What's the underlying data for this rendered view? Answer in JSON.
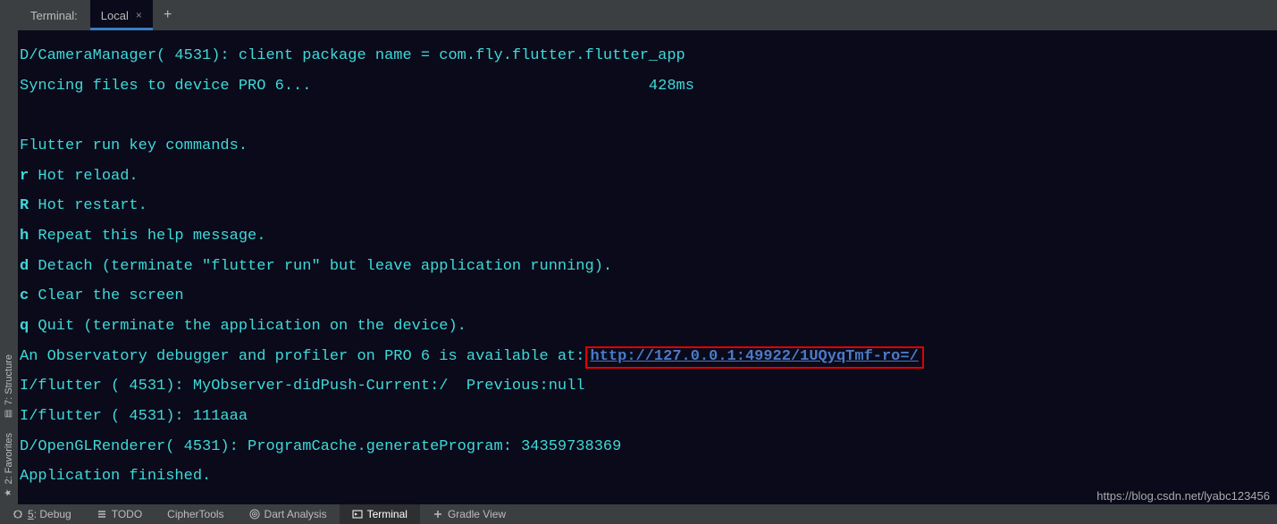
{
  "tabBar": {
    "label": "Terminal:",
    "activeTab": "Local",
    "addIcon": "+"
  },
  "sidebar": {
    "items": [
      {
        "label": "7: Structure",
        "icon": "▤"
      },
      {
        "label": "2: Favorites",
        "icon": "★"
      }
    ]
  },
  "terminal": {
    "lines": [
      {
        "type": "plain",
        "text": "D/CameraManager( 4531): client package name = com.fly.flutter.flutter_app"
      },
      {
        "type": "sync",
        "left": "Syncing files to device PRO 6...",
        "right": "428ms"
      },
      {
        "type": "blank",
        "text": ""
      },
      {
        "type": "plain",
        "text": "Flutter run key commands."
      },
      {
        "type": "cmd",
        "key": "r",
        "desc": " Hot reload."
      },
      {
        "type": "cmd",
        "key": "R",
        "desc": " Hot restart."
      },
      {
        "type": "cmd",
        "key": "h",
        "desc": " Repeat this help message."
      },
      {
        "type": "cmd",
        "key": "d",
        "desc": " Detach (terminate \"flutter run\" but leave application running)."
      },
      {
        "type": "cmd",
        "key": "c",
        "desc": " Clear the screen"
      },
      {
        "type": "cmd",
        "key": "q",
        "desc": " Quit (terminate the application on the device)."
      },
      {
        "type": "obs",
        "prefix": "An Observatory debugger and profiler on PRO 6 is available at:",
        "url": "http://127.0.0.1:49922/1UQyqTmf-ro=/"
      },
      {
        "type": "plain",
        "text": "I/flutter ( 4531): MyObserver-didPush-Current:/  Previous:null"
      },
      {
        "type": "plain",
        "text": "I/flutter ( 4531): 111aaa"
      },
      {
        "type": "plain",
        "text": "D/OpenGLRenderer( 4531): ProgramCache.generateProgram: 34359738369"
      },
      {
        "type": "plain",
        "text": "Application finished."
      }
    ]
  },
  "bottomBar": {
    "items": [
      {
        "label": "5: Debug",
        "icon": "bug",
        "hotkey": "5",
        "active": false
      },
      {
        "label": "TODO",
        "icon": "list",
        "active": false
      },
      {
        "label": "CipherTools",
        "icon": "",
        "active": false
      },
      {
        "label": "Dart Analysis",
        "icon": "dart",
        "active": false
      },
      {
        "label": "Terminal",
        "icon": "terminal",
        "active": true
      },
      {
        "label": "Gradle View",
        "icon": "plus",
        "active": false
      }
    ]
  },
  "watermark": "https://blog.csdn.net/lyabc123456"
}
